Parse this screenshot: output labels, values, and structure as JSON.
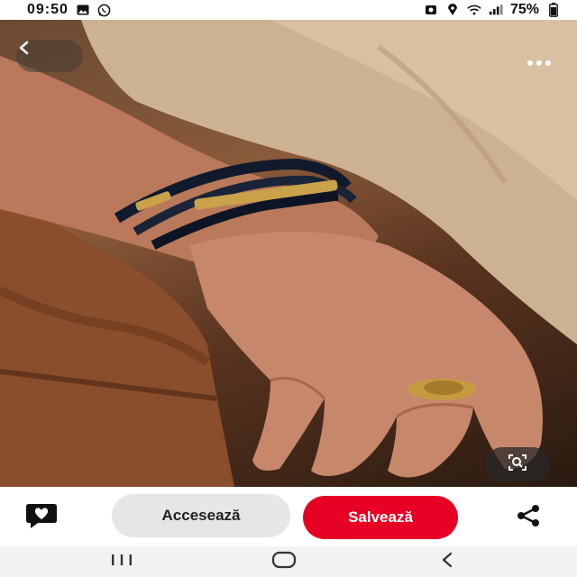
{
  "status_bar": {
    "time": "09:50",
    "battery": "75%",
    "left_icons": [
      "gallery-icon",
      "whatsapp-icon"
    ],
    "right_icons": [
      "screenshot-icon",
      "location-icon",
      "wifi-icon",
      "signal-icon"
    ]
  },
  "pin": {
    "back_icon": "chevron-left-icon",
    "more_icon": "more-horizontal-icon",
    "lens_icon": "visual-search-icon"
  },
  "actions": {
    "comment_icon": "comment-heart-icon",
    "access_label": "Accesează",
    "save_label": "Salvează",
    "share_icon": "share-icon"
  },
  "nav_bar": {
    "buttons": [
      "recent-apps-icon",
      "home-icon",
      "back-icon"
    ]
  },
  "colors": {
    "save_button": "#e60023",
    "access_button": "#e6e6e6"
  }
}
